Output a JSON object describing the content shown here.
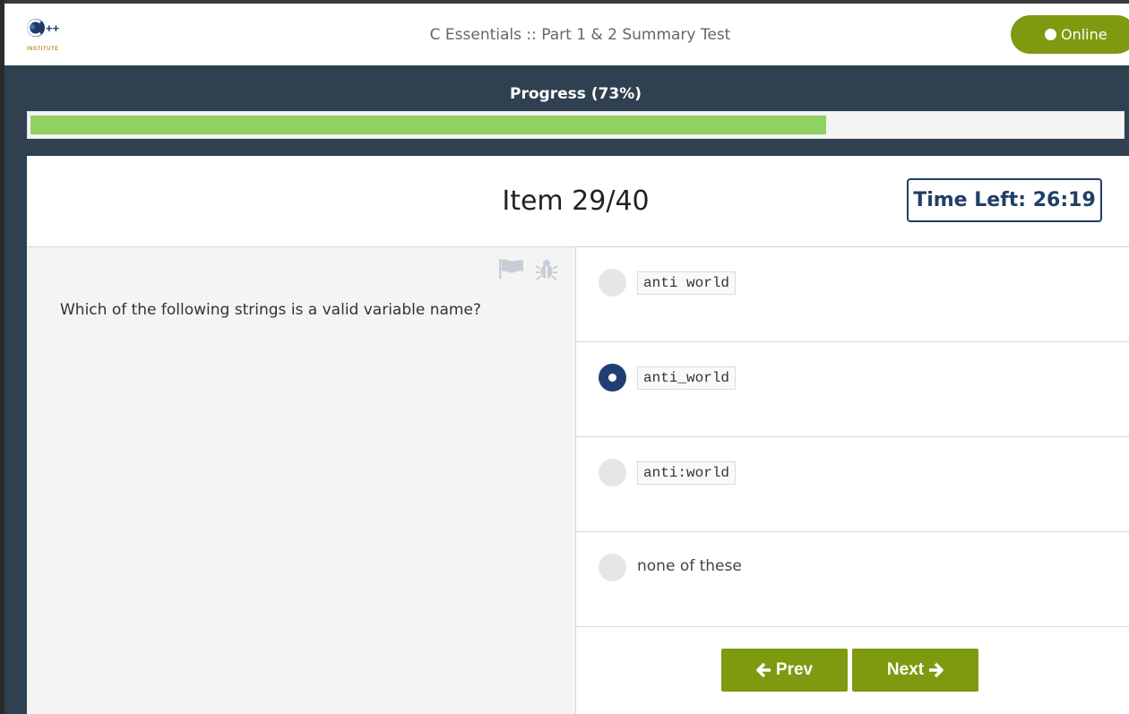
{
  "header": {
    "logo_text": "C++ INSTITUTE",
    "title": "C Essentials :: Part 1 & 2 Summary Test",
    "status_label": "Online"
  },
  "progress": {
    "label": "Progress (73%)",
    "percent": 73
  },
  "item": {
    "title": "Item 29/40",
    "timer": "Time Left: 26:19"
  },
  "question": {
    "text": "Which of the following strings is a valid variable name?",
    "icons": [
      "flag-icon",
      "bug-icon"
    ]
  },
  "answers": [
    {
      "label": "anti world",
      "code": true,
      "selected": false
    },
    {
      "label": "anti_world",
      "code": true,
      "selected": true
    },
    {
      "label": "anti:world",
      "code": true,
      "selected": false
    },
    {
      "label": "none of these",
      "code": false,
      "selected": false
    }
  ],
  "nav": {
    "prev_label": "Prev",
    "next_label": "Next"
  },
  "colors": {
    "accent_green": "#7e9a10",
    "progress_green": "#8fd163",
    "dark_blue": "#1f3f66",
    "background": "#2f4050"
  }
}
